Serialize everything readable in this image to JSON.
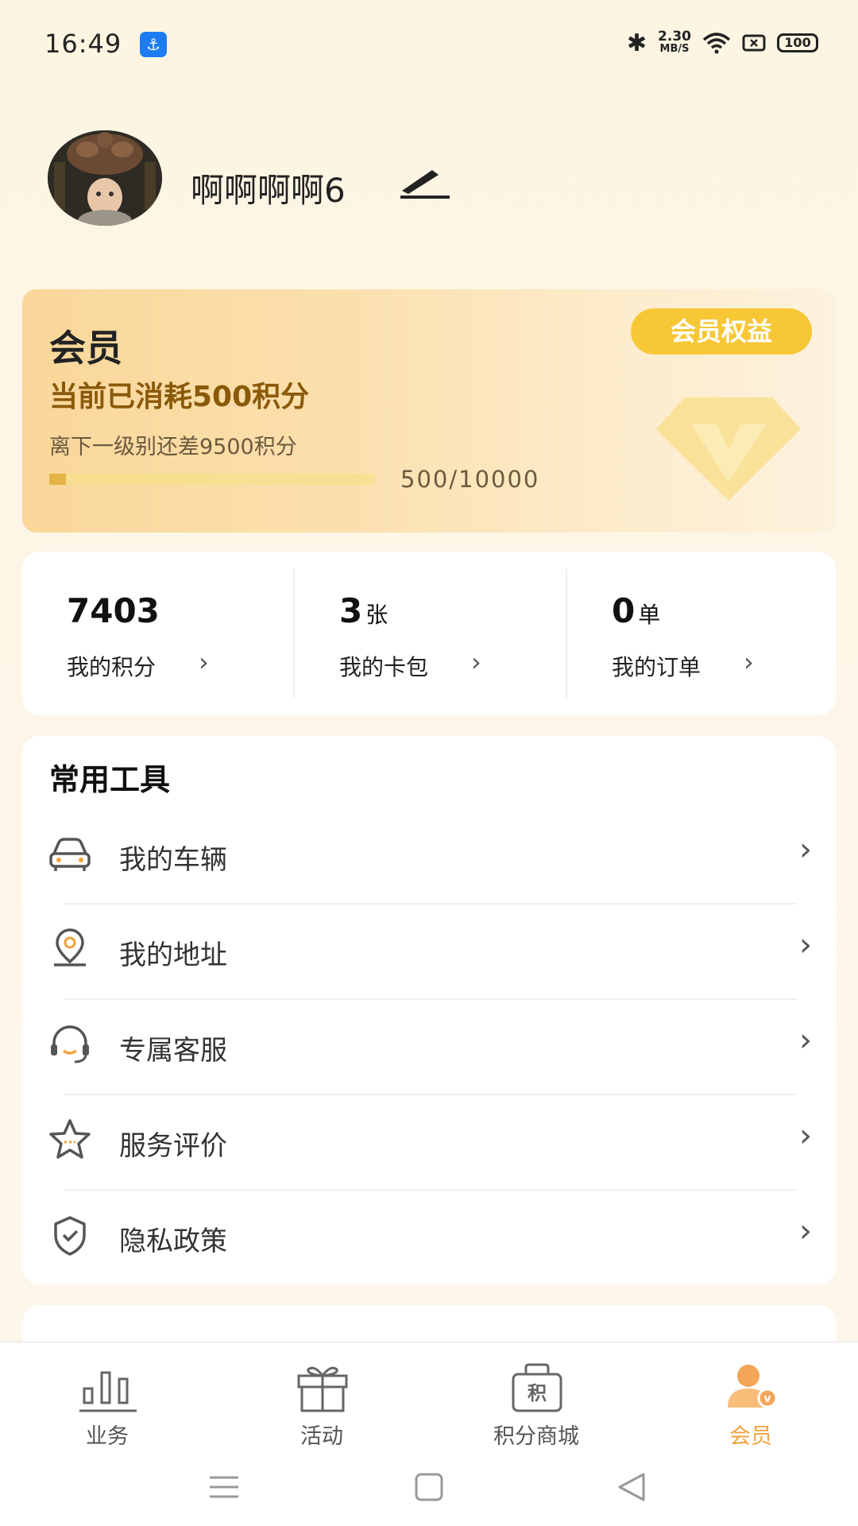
{
  "status_bar": {
    "time": "16:49",
    "net_speed": "2.30",
    "net_unit": "MB/S",
    "battery": "100",
    "icons": [
      "usb-app-icon",
      "bluetooth-icon",
      "wifi-icon",
      "sim-icon",
      "battery-icon"
    ]
  },
  "profile": {
    "username": "啊啊啊啊6",
    "edit_icon": "pen-edit-icon"
  },
  "member": {
    "title": "会员",
    "consumed": "当前已消耗500积分",
    "gap": "离下一级别还差9500积分",
    "progress_text": "500/10000",
    "progress_fraction": 0.05,
    "benefit_button": "会员权益",
    "colors": {
      "accent": "#f7c736",
      "consumed_text": "#8a5a0a"
    }
  },
  "stats": [
    {
      "value": "7403",
      "unit": "",
      "label": "我的积分"
    },
    {
      "value": "3",
      "unit": "张",
      "label": "我的卡包"
    },
    {
      "value": "0",
      "unit": "单",
      "label": "我的订单"
    }
  ],
  "tools": {
    "title": "常用工具",
    "items": [
      {
        "label": "我的车辆",
        "icon": "car-icon"
      },
      {
        "label": "我的地址",
        "icon": "location-pin-icon"
      },
      {
        "label": "专属客服",
        "icon": "headset-icon"
      },
      {
        "label": "服务评价",
        "icon": "star-icon"
      },
      {
        "label": "隐私政策",
        "icon": "shield-check-icon"
      }
    ]
  },
  "bottom_nav": [
    {
      "label": "业务",
      "icon": "bar-chart-icon",
      "active": false
    },
    {
      "label": "活动",
      "icon": "gift-icon",
      "active": false
    },
    {
      "label": "积分商城",
      "icon": "points-shop-icon",
      "active": false
    },
    {
      "label": "会员",
      "icon": "member-user-icon",
      "active": true
    }
  ],
  "system_nav": [
    "menu-lines-icon",
    "home-square-icon",
    "back-triangle-icon"
  ]
}
